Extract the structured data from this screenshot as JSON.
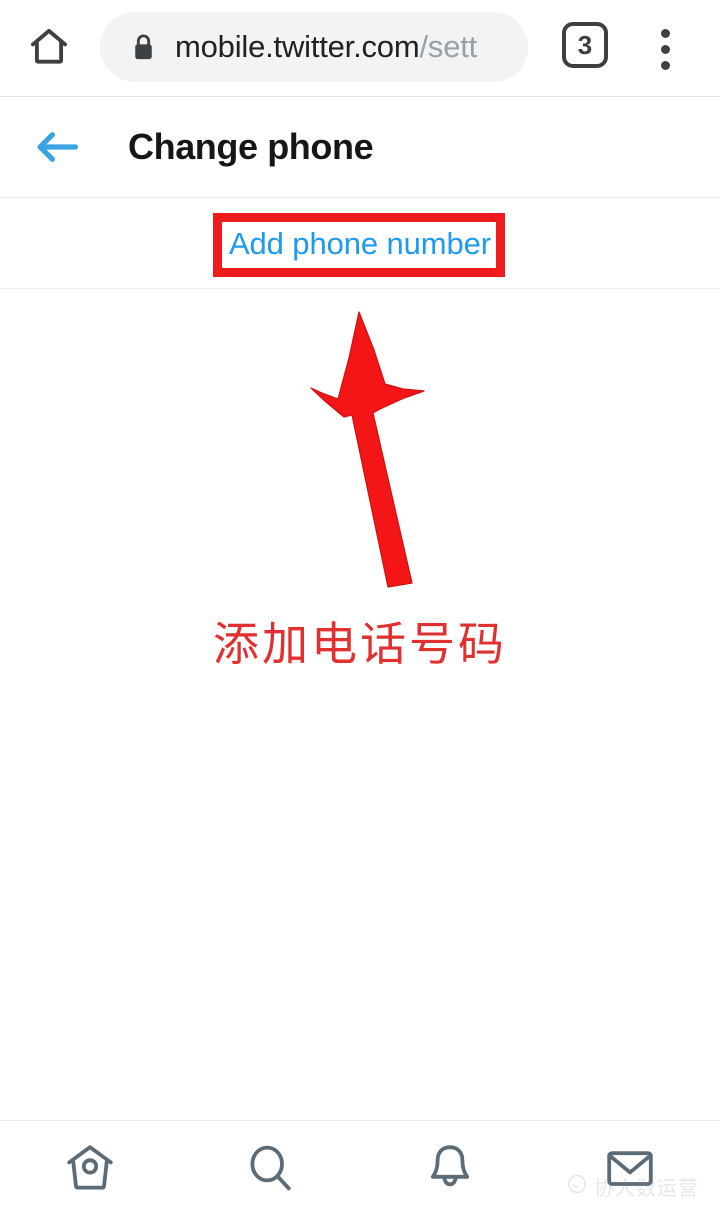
{
  "browser": {
    "home_icon": "home-icon",
    "lock_icon": "lock-icon",
    "url_domain": "mobile.twitter.com",
    "url_path": "/sett",
    "tab_count": "3",
    "menu_icon": "overflow-menu-icon"
  },
  "header": {
    "back_icon": "back-arrow-icon",
    "title": "Change phone"
  },
  "content": {
    "add_phone_label": "Add phone number"
  },
  "annotations": {
    "highlight_color": "#ee1c1c",
    "arrow_color": "#f41616",
    "caption": "添加电话号码",
    "caption_color": "#e03030"
  },
  "bottom_nav": {
    "items": [
      {
        "name": "home",
        "icon": "home-icon"
      },
      {
        "name": "search",
        "icon": "search-icon"
      },
      {
        "name": "notifications",
        "icon": "bell-icon"
      },
      {
        "name": "messages",
        "icon": "mail-icon"
      }
    ]
  },
  "watermark": {
    "text": "协人数运营"
  },
  "colors": {
    "twitter_blue": "#1d9bf0",
    "text_primary": "#14171a",
    "url_bar_bg": "#f1f3f4",
    "divider": "#e6ecf0"
  }
}
